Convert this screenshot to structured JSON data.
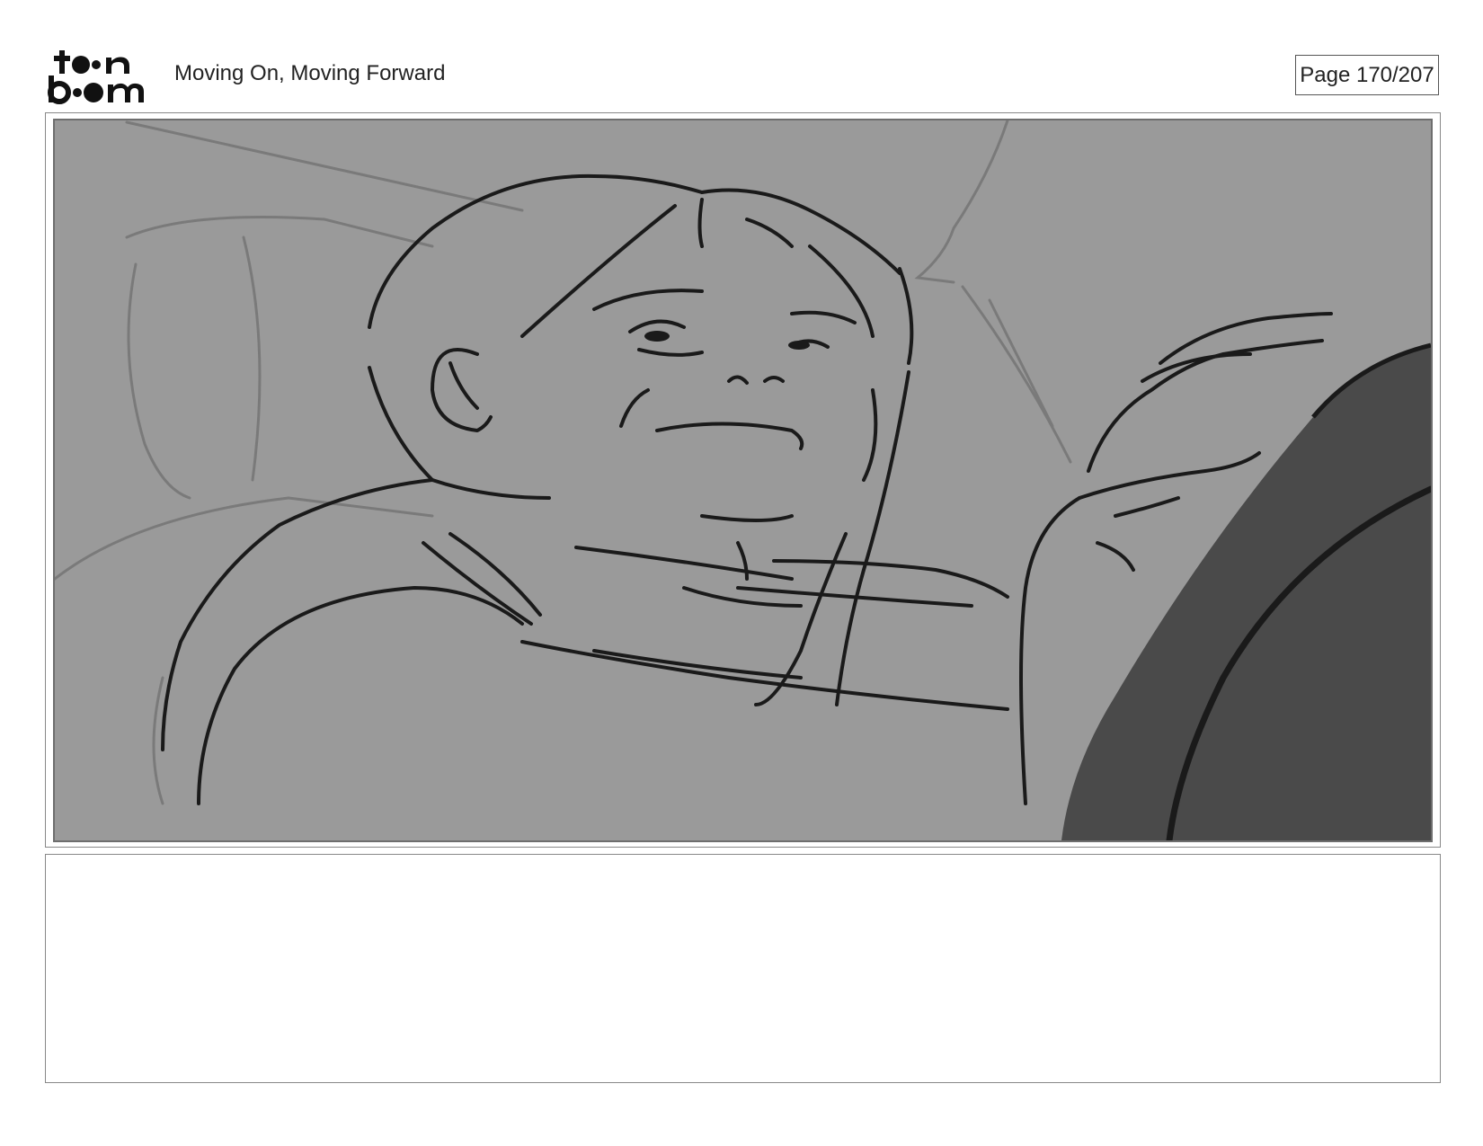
{
  "header": {
    "title": "Moving On, Moving Forward",
    "page_label": "Page 170/207"
  },
  "logo": {
    "text_line1": "toon",
    "text_line2": "boom",
    "icon": "toon-boom-logo"
  },
  "panel": {
    "image_description_icon": "storyboard-sketch",
    "background_color": "#9a9a9a",
    "dark_shape_color": "#4a4a4a",
    "line_color": "#1a1a1a"
  },
  "notes": {
    "text": ""
  }
}
